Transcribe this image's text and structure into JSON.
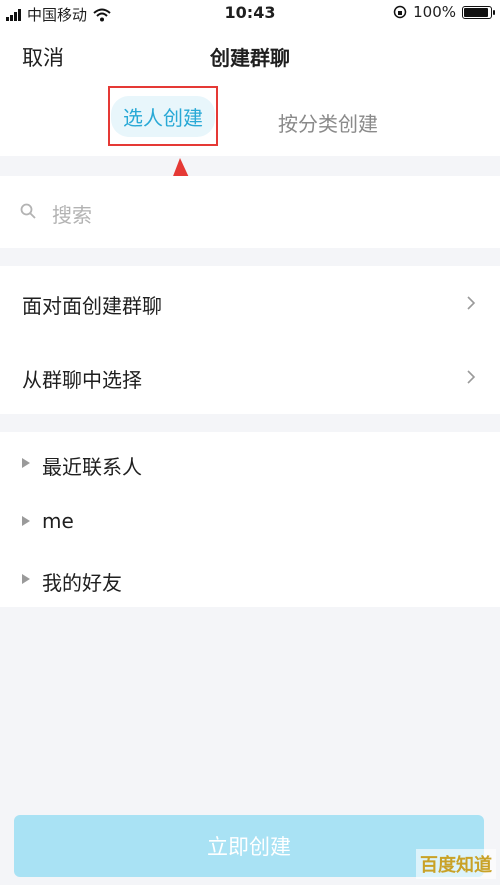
{
  "status_bar": {
    "carrier": "中国移动",
    "time": "10:43",
    "battery": "100%",
    "battery_level": 1.0
  },
  "nav": {
    "cancel": "取消",
    "title": "创建群聊"
  },
  "tabs": [
    {
      "label": "选人创建",
      "active": true
    },
    {
      "label": "按分类创建",
      "active": false
    }
  ],
  "search": {
    "placeholder": "搜索"
  },
  "menu": [
    {
      "label": "面对面创建群聊"
    },
    {
      "label": "从群聊中选择"
    }
  ],
  "groups": [
    {
      "label": "最近联系人"
    },
    {
      "label": "me"
    },
    {
      "label": "我的好友"
    }
  ],
  "create_button": "立即创建",
  "watermark": "百度知道",
  "colors": {
    "accent": "#29a9d6",
    "highlight_box": "#e53935",
    "button_disabled": "#a9e2f4",
    "background": "#f4f5f8"
  }
}
